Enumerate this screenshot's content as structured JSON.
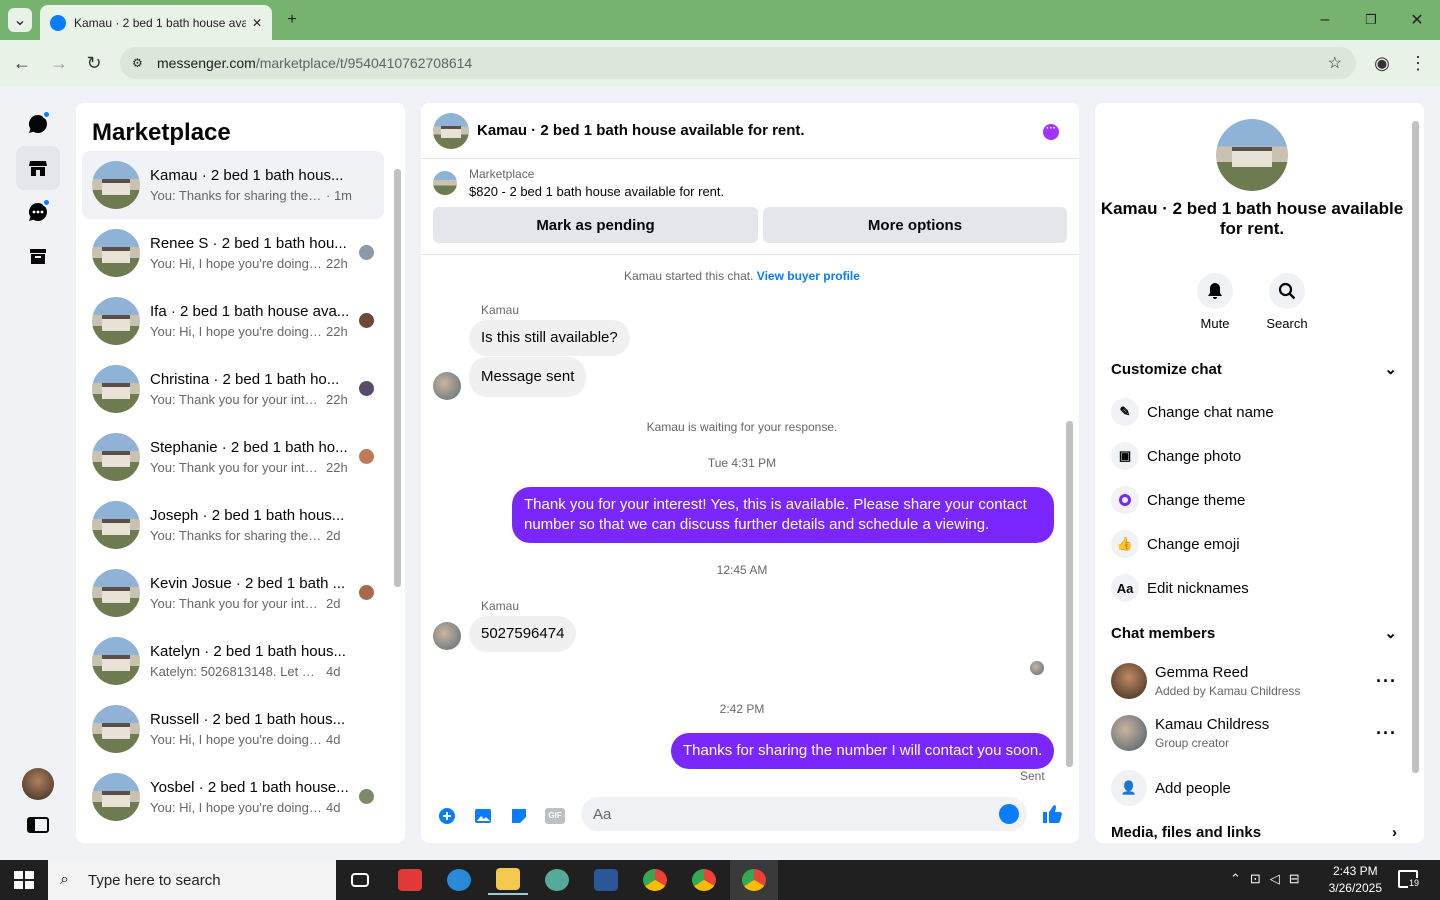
{
  "browser": {
    "tab_title": "Kamau · 2 bed 1 bath house ava...",
    "url_host": "messenger.com",
    "url_path": "/marketplace/t/9540410762708614"
  },
  "rail": {
    "icons": [
      "chats-icon",
      "marketplace-icon",
      "requests-icon",
      "archive-icon"
    ]
  },
  "left_panel": {
    "title": "Marketplace",
    "conversations": [
      {
        "name": "Kamau · 2 bed 1 bath hous...",
        "preview": "You: Thanks for sharing the ...",
        "time": "· 1m"
      },
      {
        "name": "Renee S · 2 bed 1 bath hou...",
        "preview": "You: Hi, I hope you're doing ...",
        "time": "22h"
      },
      {
        "name": "Ifa · 2 bed 1 bath house ava...",
        "preview": "You: Hi, I hope you're doing ...",
        "time": "22h"
      },
      {
        "name": "Christina · 2 bed 1 bath ho...",
        "preview": "You: Thank you for your inte...",
        "time": "22h"
      },
      {
        "name": "Stephanie · 2 bed 1 bath ho...",
        "preview": "You: Thank you for your inte...",
        "time": "22h"
      },
      {
        "name": "Joseph · 2 bed 1 bath hous...",
        "preview": "You: Thanks for sharing the n...",
        "time": "2d"
      },
      {
        "name": "Kevin Josue · 2 bed 1 bath ...",
        "preview": "You: Thank you for your inter...",
        "time": "2d"
      },
      {
        "name": "Katelyn · 2 bed 1 bath hous...",
        "preview": "Katelyn: 5026813148. Let me ...",
        "time": "4d"
      },
      {
        "name": "Russell · 2 bed 1 bath hous...",
        "preview": "You: Hi, I hope you're doing ...",
        "time": "4d"
      },
      {
        "name": "Yosbel · 2 bed 1 bath house...",
        "preview": "You: Hi, I hope you're doing ...",
        "time": "4d"
      }
    ]
  },
  "chat": {
    "header_title": "Kamau · 2 bed 1 bath house available for rent.",
    "listing_label": "Marketplace",
    "listing_title": "$820 - 2 bed 1 bath house available for rent.",
    "mark_pending": "Mark as pending",
    "more_options": "More options",
    "started_text": "Kamau started this chat.",
    "view_buyer": "View buyer profile",
    "sender1": "Kamau",
    "msg1": "Is this still available?",
    "msg2": "Message sent",
    "waiting": "Kamau is waiting for your response.",
    "time1": "Tue 4:31 PM",
    "msg3": "Thank you for your interest! Yes, this is available. Please share your contact number so that we can discuss further details and schedule a viewing.",
    "time2": "12:45 AM",
    "sender2": "Kamau",
    "msg4": "5027596474",
    "time3": "2:42 PM",
    "msg5": "Thanks for sharing the number I will contact you soon.",
    "status": "Sent",
    "placeholder": "Aa",
    "accent": "#7a26ff"
  },
  "right_panel": {
    "title": "Kamau · 2 bed 1 bath house available for rent.",
    "mute": "Mute",
    "search": "Search",
    "customize": "Customize chat",
    "items": [
      "Change chat name",
      "Change photo",
      "Change theme",
      "Change emoji",
      "Edit nicknames"
    ],
    "members_label": "Chat members",
    "members": [
      {
        "name": "Gemma Reed",
        "sub": "Added by Kamau Childress"
      },
      {
        "name": "Kamau Childress",
        "sub": "Group creator"
      }
    ],
    "add_people": "Add people",
    "media": "Media, files and links"
  },
  "taskbar": {
    "search": "Type here to search",
    "time": "2:43 PM",
    "date": "3/26/2025",
    "notifications": "19"
  }
}
